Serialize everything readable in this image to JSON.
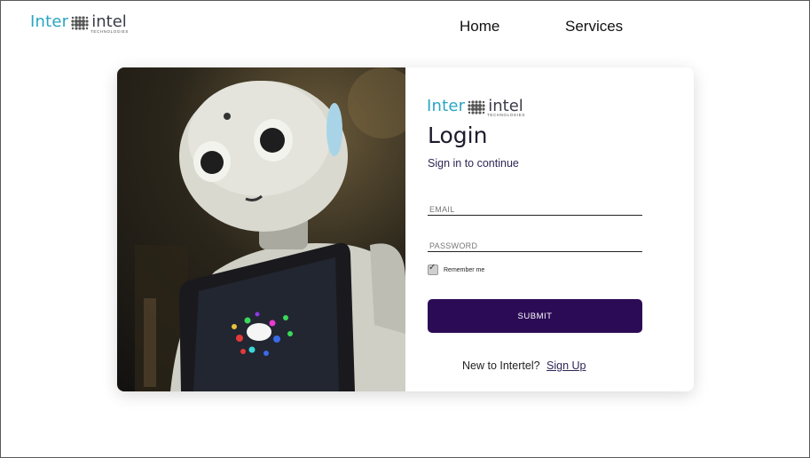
{
  "header": {
    "logo": {
      "part1": "Inter",
      "part2": "intel",
      "tagline": "TECHNOLOGIES"
    },
    "nav": [
      {
        "label": "Home"
      },
      {
        "label": "Services"
      }
    ]
  },
  "login": {
    "logo": {
      "part1": "Inter",
      "part2": "intel",
      "tagline": "TECHNOLOGIES"
    },
    "title": "Login",
    "subtitle": "Sign in to continue",
    "email_placeholder": "EMAIL",
    "password_placeholder": "PASSWORD",
    "remember_label": "Remember me",
    "remember_checked": true,
    "submit_label": "SUBMIT",
    "signup_prompt": "New to Intertel?",
    "signup_link": "Sign Up"
  },
  "image": {
    "subject": "humanoid robot holding a tablet"
  },
  "colors": {
    "brand_teal": "#2aa5c4",
    "button_purple": "#2c0b56",
    "text_dark": "#1e1b2e"
  }
}
